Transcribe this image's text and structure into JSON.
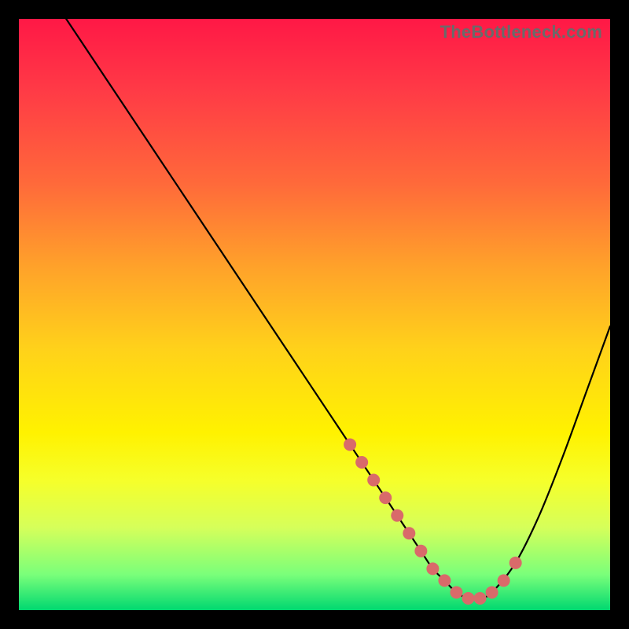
{
  "watermark": "TheBottleneck.com",
  "chart_data": {
    "type": "line",
    "title": "",
    "xlabel": "",
    "ylabel": "",
    "xlim": [
      0,
      100
    ],
    "ylim": [
      0,
      100
    ],
    "grid": false,
    "legend": false,
    "series": [
      {
        "name": "bottleneck-curve",
        "x": [
          8,
          12,
          16,
          20,
          24,
          28,
          32,
          36,
          40,
          44,
          48,
          52,
          56,
          60,
          62,
          64,
          66,
          68,
          70,
          72,
          74,
          76,
          78,
          80,
          84,
          88,
          92,
          96,
          100
        ],
        "y": [
          100,
          94,
          88,
          82,
          76,
          70,
          64,
          58,
          52,
          46,
          40,
          34,
          28,
          22,
          19,
          16,
          13,
          10,
          7,
          5,
          3,
          2,
          2,
          3,
          8,
          16,
          26,
          37,
          48
        ]
      }
    ],
    "markers": {
      "name": "highlighted-points",
      "x": [
        56,
        58,
        60,
        62,
        64,
        66,
        68,
        70,
        72,
        74,
        76,
        78,
        80,
        82,
        84
      ],
      "y": [
        28,
        25,
        22,
        19,
        16,
        13,
        10,
        7,
        5,
        3,
        2,
        2,
        3,
        5,
        8
      ]
    }
  }
}
